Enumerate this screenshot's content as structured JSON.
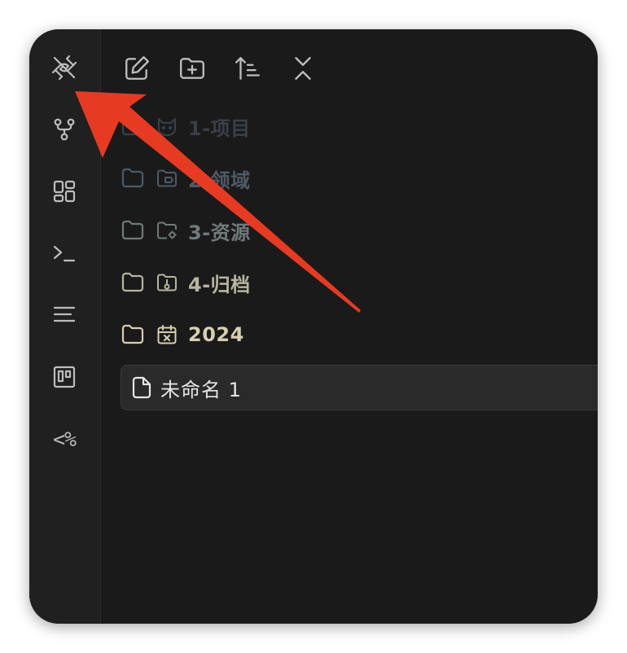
{
  "ribbon": {
    "items": [
      {
        "icon": "plugin-disconnect-icon"
      },
      {
        "icon": "git-branch-icon"
      },
      {
        "icon": "dashboard-grid-icon"
      },
      {
        "icon": "terminal-icon"
      },
      {
        "icon": "outline-lines-icon"
      },
      {
        "icon": "kanban-board-icon"
      },
      {
        "icon": "templater-icon",
        "label": "<%"
      }
    ]
  },
  "toolbar": {
    "items": [
      {
        "icon": "new-note-icon"
      },
      {
        "icon": "new-folder-icon"
      },
      {
        "icon": "sort-order-icon"
      },
      {
        "icon": "collapse-all-icon"
      }
    ]
  },
  "tree": {
    "items": [
      {
        "label": "1-项目",
        "color": "#3a3f4a",
        "emoji_icon": "cat-icon"
      },
      {
        "label": "2-领域",
        "color": "#4e5a66",
        "emoji_icon": "folder-tag-icon"
      },
      {
        "label": "3-资源",
        "color": "#707a7a",
        "emoji_icon": "folder-gear-icon"
      },
      {
        "label": "4-归档",
        "color": "#b7b59f",
        "emoji_icon": "folder-archive-icon"
      },
      {
        "label": "2024",
        "color": "#d8cfb0",
        "emoji_icon": "calendar-x-icon"
      }
    ],
    "file": {
      "label": "未命名 1"
    }
  },
  "colors": {
    "arrow": "#e63a22",
    "window_bg": "#1c1c1c",
    "ribbon_bg": "#202020",
    "icon": "#bdbdbd"
  }
}
